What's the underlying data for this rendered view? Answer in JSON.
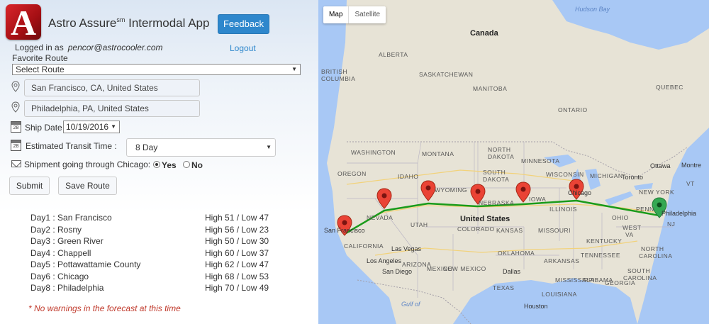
{
  "header": {
    "logo_letter": "A",
    "title_main": "Astro Assure",
    "title_sup": "sm",
    "title_rest": " Intermodal App",
    "feedback_label": "Feedback",
    "logged_in_label": "Logged in as",
    "user_email": "pencor@astrocooler.com",
    "logout_label": "Logout"
  },
  "route_form": {
    "favorite_route_label": "Favorite Route",
    "favorite_route_value": "Select Route",
    "origin": "San Francisco, CA, United States",
    "destination": "Philadelphia, PA, United States",
    "ship_date_label": "Ship Date",
    "ship_date_value": "10/19/2016",
    "calendar_icon_text": "28",
    "transit_time_label": "Estimated Transit Time :",
    "transit_time_value": "8 Day",
    "chicago_label": "Shipment going through Chicago:",
    "chicago_yes": "Yes",
    "chicago_no": "No",
    "chicago_selected": "Yes",
    "submit_label": "Submit",
    "save_route_label": "Save Route"
  },
  "forecast": [
    {
      "day": "Day1 : San Francisco",
      "temp": "High 51 / Low 47"
    },
    {
      "day": "Day2 : Rosny",
      "temp": "High 56 / Low 23"
    },
    {
      "day": "Day3 : Green River",
      "temp": "High 50 / Low 30"
    },
    {
      "day": "Day4 : Chappell",
      "temp": "High 60 / Low 37"
    },
    {
      "day": "Day5 : Pottawattamie County",
      "temp": "High 62 / Low 47"
    },
    {
      "day": "Day6 : Chicago",
      "temp": "High 68 / Low 53"
    },
    {
      "day": "Day8 : Philadelphia",
      "temp": "High 70 / Low 49"
    }
  ],
  "warning": "* No warnings in the forecast at this time",
  "map": {
    "type_map": "Map",
    "type_satellite": "Satellite",
    "labels": {
      "hudson_bay": "Hudson Bay",
      "canada": "Canada",
      "alberta": "ALBERTA",
      "british_columbia": "BRITISH\nCOLUMBIA",
      "saskatchewan": "SASKATCHEWAN",
      "manitoba": "MANITOBA",
      "ontario": "ONTARIO",
      "quebec": "QUEBEC",
      "washington": "WASHINGTON",
      "montana": "MONTANA",
      "north_dakota": "NORTH\nDAKOTA",
      "minnesota": "MINNESOTA",
      "oregon": "OREGON",
      "idaho": "IDAHO",
      "south_dakota": "SOUTH\nDAKOTA",
      "wisconsin": "WISCONSIN",
      "michigan": "MICHIGAN",
      "wyoming": "WYOMING",
      "nebraska": "NEBRASKA",
      "iowa": "IOWA",
      "illinois": "ILLINOIS",
      "ohio": "OHIO",
      "penn": "PENN",
      "nevada": "NEVADA",
      "utah": "UTAH",
      "colorado": "COLORADO",
      "kansas": "KANSAS",
      "missouri": "MISSOURI",
      "west_va": "WEST\nVA",
      "kentucky": "KENTUCKY",
      "california": "CALIFORNIA",
      "arizona": "ARIZONA",
      "new_mexico": "NEW MEXICO",
      "oklahoma": "OKLAHOMA",
      "tennessee": "TENNESSEE",
      "north_carolina": "NORTH\nCAROLINA",
      "arkansas": "ARKANSAS",
      "south_carolina": "SOUTH\nCAROLINA",
      "mississippi": "MISSISSIPPI",
      "alabama": "ALABAMA",
      "georgia": "GEORGIA",
      "louisiana": "LOUISIANA",
      "texas": "TEXAS",
      "united_states": "United States",
      "new_york": "NEW YORK",
      "toronto": "Toronto",
      "ottawa": "Ottawa",
      "montreal": "Montre",
      "vt": "VT",
      "nj": "NJ",
      "chicago": "Chicago",
      "philadelphia": "Philadelphia",
      "san_francisco": "San Francisco",
      "las_vegas": "Las Vegas",
      "los_angeles": "Los Angeles",
      "san_diego": "San Diego",
      "dallas": "Dallas",
      "houston": "Houston",
      "mexico": "MEXICO",
      "gulf": "Gulf of"
    }
  }
}
